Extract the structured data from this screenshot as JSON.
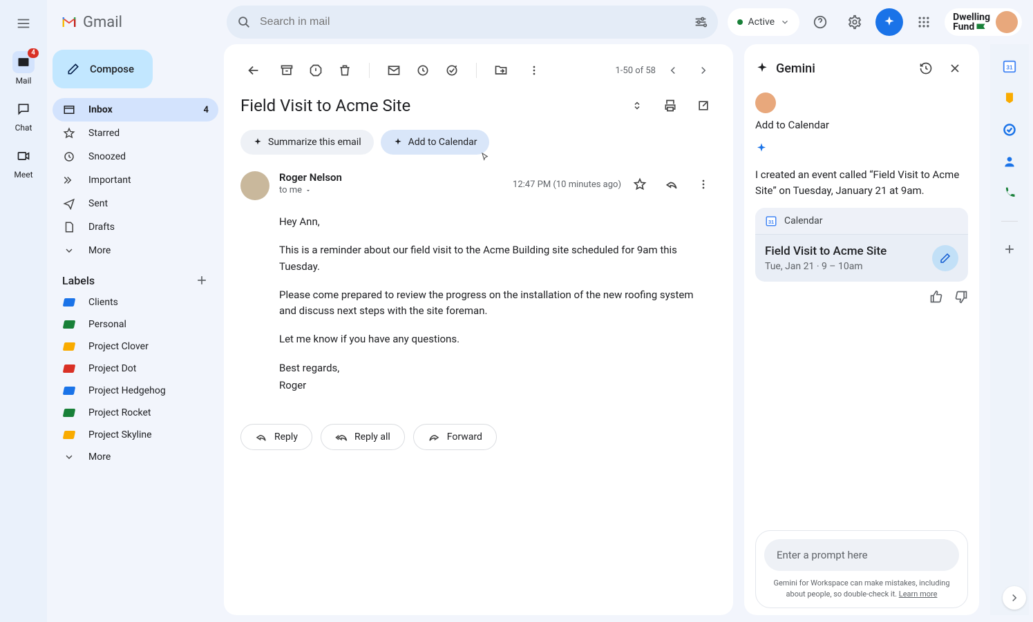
{
  "brand": "Gmail",
  "rail": {
    "badge": "4",
    "items": [
      {
        "label": "Mail"
      },
      {
        "label": "Chat"
      },
      {
        "label": "Meet"
      }
    ]
  },
  "search": {
    "placeholder": "Search in mail"
  },
  "status": {
    "label": "Active"
  },
  "org": {
    "line1": "Dwelling",
    "line2": "Fund"
  },
  "compose_label": "Compose",
  "nav": {
    "items": [
      {
        "label": "Inbox",
        "count": "4",
        "selected": true
      },
      {
        "label": "Starred"
      },
      {
        "label": "Snoozed"
      },
      {
        "label": "Important"
      },
      {
        "label": "Sent"
      },
      {
        "label": "Drafts"
      },
      {
        "label": "More"
      }
    ]
  },
  "labels_header": "Labels",
  "labels": [
    {
      "label": "Clients",
      "color": "#1a73e8"
    },
    {
      "label": "Personal",
      "color": "#188038"
    },
    {
      "label": "Project Clover",
      "color": "#f9ab00"
    },
    {
      "label": "Project Dot",
      "color": "#d93025"
    },
    {
      "label": "Project Hedgehog",
      "color": "#1a73e8"
    },
    {
      "label": "Project Rocket",
      "color": "#188038"
    },
    {
      "label": "Project Skyline",
      "color": "#f9ab00"
    }
  ],
  "labels_more": "More",
  "toolbar": {
    "range": "1-50 of 58"
  },
  "email": {
    "subject": "Field Visit to Acme Site",
    "chip_summarize": "Summarize this email",
    "chip_calendar": "Add to Calendar",
    "from": "Roger Nelson",
    "to": "to me",
    "time": "12:47 PM (10 minutes ago)",
    "p1": "Hey Ann,",
    "p2": "This is a reminder about our field visit to the Acme Building site scheduled for 9am this Tuesday.",
    "p3": "Please come prepared to review the progress on the installation of the new roofing system and discuss next steps with the site foreman.",
    "p4": "Let me know if you have any questions.",
    "p5": "Best regards,",
    "p6": "Roger",
    "reply": "Reply",
    "reply_all": "Reply all",
    "forward": "Forward"
  },
  "gemini": {
    "title": "Gemini",
    "section": "Add to Calendar",
    "message": "I created an event called “Field Visit to Acme Site” on Tuesday, January 21 at 9am.",
    "cal_app": "Calendar",
    "event_title": "Field Visit to Acme Site",
    "event_sub": "Tue, Jan 21 · 9 – 10am",
    "prompt_placeholder": "Enter a prompt here",
    "disclaimer_a": "Gemini for Workspace can make mistakes, including about people, so double-check it. ",
    "disclaimer_b": "Learn more"
  }
}
